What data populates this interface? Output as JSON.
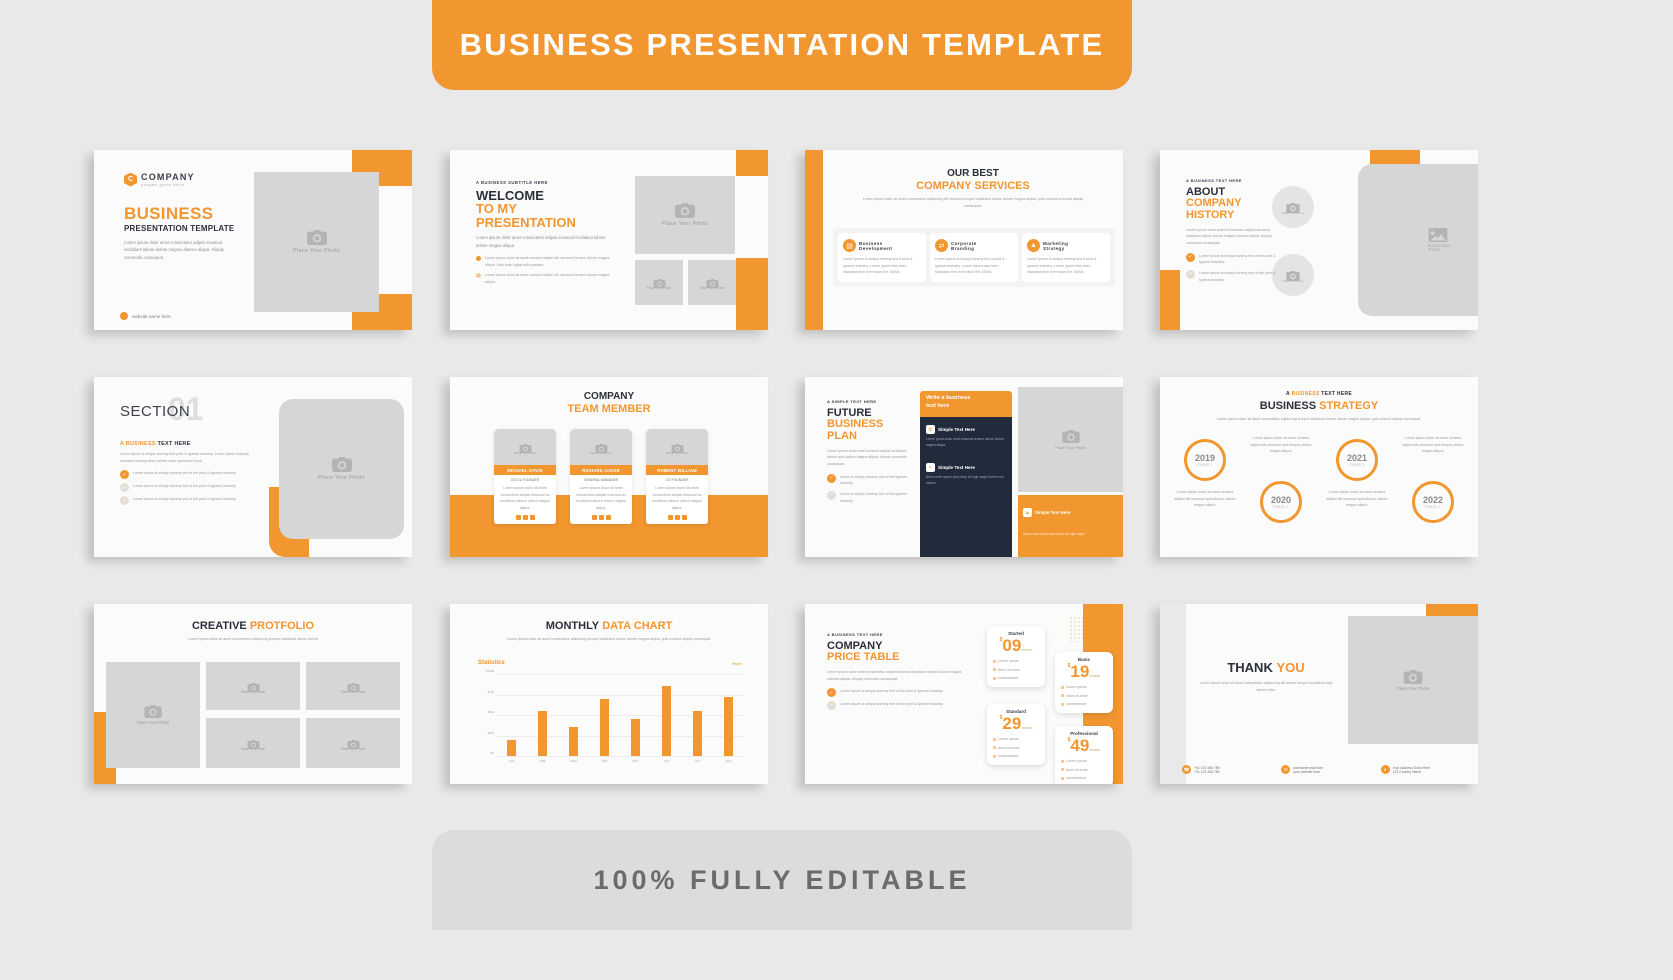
{
  "banner": {
    "title": "BUSINESS PRESENTATION TEMPLATE"
  },
  "footer": {
    "text": "100% FULLY EDITABLE"
  },
  "colors": {
    "accent": "#f2962f",
    "dark": "#2b2f3a",
    "navy": "#222b3c",
    "placeholder": "#d6d6d6",
    "page_bg": "#e9e9e9"
  },
  "common": {
    "place_photo": "Place Your Photo",
    "place_here": "PLACE YOUR PHOTO",
    "lorem_short": "Lorem ipsum dolor amet consectetur adipisi eiusmod incididunt labore dolore magna ullamco aliqua. Aliquip commodo consequat.",
    "lorem_item": "Lorem ipsum is simply dummy text of the print & typeset industry."
  },
  "slides": {
    "s1": {
      "logo_letter": "C",
      "company": "COMPANY",
      "slogan": "slogan goes here",
      "title_orange": "BUSINESS",
      "title_dark": "PRESENTATION TEMPLATE",
      "body": "Lorem ipsum dolor amet consectetur adipisi eiusmod incididunt labore dolore magna ullamco aliqua. Aliquip commodo consequat.",
      "website": "website name here",
      "photo_label": "Place Your Photo"
    },
    "s2": {
      "eyebrow": "A BUSINESS SUBTITLE HERE",
      "title_dark": "WELCOME",
      "title_orange1": "TO MY",
      "title_orange2": "PRESENTATION",
      "body": "Lorem ipsum dolor amet consectetur adipisi eiusmod incididunt labore dolore magna aliqua.",
      "bullets": [
        "Lorem ipsum dolor sit amet consect adipisi elit, eiusmod tempor dolore magna aliqua. Duis aute fugiat nulla pariatur.",
        "Lorem ipsum dolor sit amet consect adipisi elit, eiusmod tempor dolore magna aliqua."
      ],
      "photo_label": "Place Your Photo",
      "photo_label_small": "Place Your Photo"
    },
    "s3": {
      "title_dark": "OUR BEST",
      "title_orange": "COMPANY SERVICES",
      "subtitle": "Lorem ipsum dolor sit amet consectetur adipiscing elit eiusmod tempor incididunt labore dolore magna aliqua, quis nostrud exercitat aliquip consequat.",
      "services": [
        {
          "title1": "Business",
          "title2": "Development",
          "icon": "document-icon",
          "body": "Lorem ipsum is simply dummy text a print & typeset industry. Lorem ipsum has been standard ever ever since the 1500s."
        },
        {
          "title1": "Corporate",
          "title2": "Branding",
          "icon": "exchange-icon",
          "body": "Lorem ipsum is simply dummy text a print & typeset industry. Lorem ipsum has been standard ever ever since the 1500s."
        },
        {
          "title1": "Marketing",
          "title2": "Strategy",
          "icon": "chart-icon",
          "body": "Lorem ipsum is simply dummy text a print & typeset industry. Lorem ipsum has been standard ever ever since the 1500s."
        }
      ]
    },
    "s4": {
      "eyebrow": "A BUSINESS TEXT HERE",
      "title_dark": "ABOUT",
      "title_orange1": "COMPANY",
      "title_orange2": "HISTORY",
      "body": "Lorem ipsum dolor amet consectetur adipisi eiusmod incididunt labore dolore magna ullamco aliqua. Aliquip commodo consequat.",
      "checks": [
        "Lorem ipsum is simply dummy text of the print & typeset industry.",
        "Lorem ipsum is simply dummy text of the print & typeset industry."
      ],
      "photo_label": "Place Your Photo",
      "big_photo_label1": "PLACE YOUR",
      "big_photo_label2": "PHOTO"
    },
    "s5": {
      "section": "SECTION",
      "number": "01",
      "eyebrow_orange": "A BUSINESS",
      "eyebrow_dark": "TEXT HERE",
      "body": "Lorem ipsum is simple dummy text print & typeset industry. Lorem ipsum industry standard dummy when printer dolor specimen book.",
      "checks": [
        "Lorem ipsum is simply dummy text of the print & typeset industry.",
        "Lorem ipsum is simply dummy text of the print & typeset industry.",
        "Lorem ipsum is simply dummy text of the print & typeset industry."
      ],
      "photo_label": "Place Your Photo"
    },
    "s6": {
      "title_dark": "COMPANY",
      "title_orange": "TEAM MEMBER",
      "members": [
        {
          "name": "MICHAEL DAVID",
          "role": "CEO & FOUNDER",
          "body": "Lorem ipsum dolor sit amet consectetur adipisi eiusmod do incididunt labore dolore magna aliqua.",
          "photo_label": "Place Your Photo"
        },
        {
          "name": "RICHARD JAKOB",
          "role": "GENERAL MANAGER",
          "body": "Lorem ipsum dolor sit amet consectetur adipisi eiusmod do incididunt labore dolore magna aliqua.",
          "photo_label": "Place Your Photo"
        },
        {
          "name": "ROBERT WILLIAM",
          "role": "CO FOUNDER",
          "body": "Lorem ipsum dolor sit amet consectetur adipisi eiusmod do incididunt labore dolore magna aliqua.",
          "photo_label": "Place Your Photo"
        }
      ]
    },
    "s7": {
      "eyebrow": "A SIMPLE TEXT HERE",
      "title_dark": "FUTURE",
      "title_orange1": "BUSINESS",
      "title_orange2": "PLAN",
      "body": "Lorem ipsum dolor amet consect adipisi incididunt labore quis dolore magna aliqua. Aliqua commodo consequat.",
      "checks": [
        "Lorem is simply dummy text of the typeset industry.",
        "Lorem is simply dummy text of the typeset industry."
      ],
      "panel_header1": "Write a business",
      "panel_header2": "text here",
      "panel_items": [
        {
          "title": "Simple Text Here",
          "icon": "gear-icon",
          "body": "Lorem ipsum dolor amet eiusmod tempor labore dolore magna aliqua."
        },
        {
          "title": "Simple Text Here",
          "icon": "share-icon",
          "body": "Nemo enim ipsam quis setup sit fugit magni dolore eos ratione."
        }
      ],
      "orange_item": {
        "title": "Simple Text Here",
        "icon": "rocket-icon",
        "body": "Nemo enim ipsam quis setup sit fugit magni"
      },
      "photo_label": "Place Your Photo"
    },
    "s8": {
      "eyebrow_a": "A",
      "eyebrow_orange": "BUSINESS",
      "eyebrow_dark": "TEXT HERE",
      "title_dark": "BUSINESS",
      "title_orange": "STRATEGY",
      "subtitle": "Lorem ipsum dolor sit amet consectetur adipiscing tempor incididunt labore dolore magna aliqua, quis nostrud aliquip consequat.",
      "phases": [
        {
          "year": "2019",
          "phase": "PHASE 1",
          "body": "Lorem ipsum dolor sit amet consect adipisi elit eiusmod quis tempor dolore magna aliqua."
        },
        {
          "year": "2020",
          "phase": "PHASE 2",
          "body": "Lorem ipsum dolor sit amet consect adipisi elit eiusmod quis tempor dolore magna aliqua."
        },
        {
          "year": "2021",
          "phase": "PHASE 3",
          "body": "Lorem ipsum dolor sit amet consect adipisi elit eiusmod quis tempor dolore magna aliqua."
        },
        {
          "year": "2022",
          "phase": "PHASE 4",
          "body": "Lorem ipsum dolor sit amet consect adipisi elit eiusmod quis tempor dolore magna aliqua."
        }
      ]
    },
    "s9": {
      "title_dark": "CREATIVE",
      "title_orange": "PROTFOLIO",
      "subtitle": "Lorem ipsum dolor sit amet consectetur adipiscing tempor incididunt labore dolore",
      "photos": [
        {
          "label": "Place Your Photo"
        },
        {
          "label": "Place Your Photo"
        },
        {
          "label": "Place Your Photo"
        },
        {
          "label": "Place Your Photo"
        },
        {
          "label": "Place Your Photo"
        }
      ]
    },
    "s10": {
      "title_dark": "MONTHLY",
      "title_orange": "DATA CHART",
      "subtitle": "Lorem ipsum dolor sit amet consectetur adipiscing tempor incididunt labore dolore magna aliqua, quis nostrud aliquip consequat.",
      "legend": "Report"
    },
    "s11": {
      "eyebrow": "A BUSINESS TEXT HERE",
      "title_dark": "COMPANY",
      "title_orange": "PRICE TABLE",
      "body": "Lorem ipsum dolor amet consectetur adipisi eiusmod incididunt labore dolore magna ullamco aliqua. Aliquip commodo consequat.",
      "checks": [
        "Lorem ipsum is simply dummy text of the print & typeset industry.",
        "Lorem ipsum is simply dummy text of the print & typeset industry."
      ],
      "plans": [
        {
          "name": "Started",
          "currency": "$",
          "price": "09",
          "period": "/month",
          "features": [
            "Lorem ipsum",
            "dolor sit amet",
            "consectetuer"
          ]
        },
        {
          "name": "Basic",
          "currency": "$",
          "price": "19",
          "period": "/month",
          "features": [
            "Lorem ipsum",
            "dolor sit amet",
            "consectetuer"
          ]
        },
        {
          "name": "Standard",
          "currency": "$",
          "price": "29",
          "period": "/month",
          "features": [
            "Lorem ipsum",
            "dolor sit amet",
            "consectetuer"
          ]
        },
        {
          "name": "Professional",
          "currency": "$",
          "price": "49",
          "period": "/month",
          "features": [
            "Lorem ipsum",
            "dolor sit amet",
            "consectetuer"
          ]
        }
      ]
    },
    "s12": {
      "title_dark": "THANK",
      "title_orange": "YOU",
      "subtitle": "Lorem ipsum dolor sit amet consectetur adipiscing elit autem tempor incididunt equi labore dolor",
      "photo_label": "Place Your Photo",
      "contacts": [
        {
          "icon": "phone-icon",
          "line1": "+01 123 456 789",
          "line2": "+01 123 456 780"
        },
        {
          "icon": "mail-icon",
          "line1": "username mail here",
          "line2": "your website here"
        },
        {
          "icon": "location-icon",
          "line1": "Your Address Goes Here",
          "line2": "123 Country Name"
        }
      ]
    }
  },
  "chart_data": {
    "type": "bar",
    "title": "Statistics",
    "categories": [
      "JAN",
      "FEB",
      "MAR",
      "APR",
      "MAY",
      "JUN",
      "JUL",
      "AUG"
    ],
    "values": [
      20,
      55,
      35,
      70,
      45,
      85,
      55,
      72
    ],
    "ytick_labels": [
      "$100k",
      "$75k",
      "$50k",
      "$25k",
      "$0"
    ],
    "ylim": [
      0,
      100
    ],
    "grid": true,
    "legend": "Report",
    "xlabel": "",
    "ylabel": ""
  }
}
